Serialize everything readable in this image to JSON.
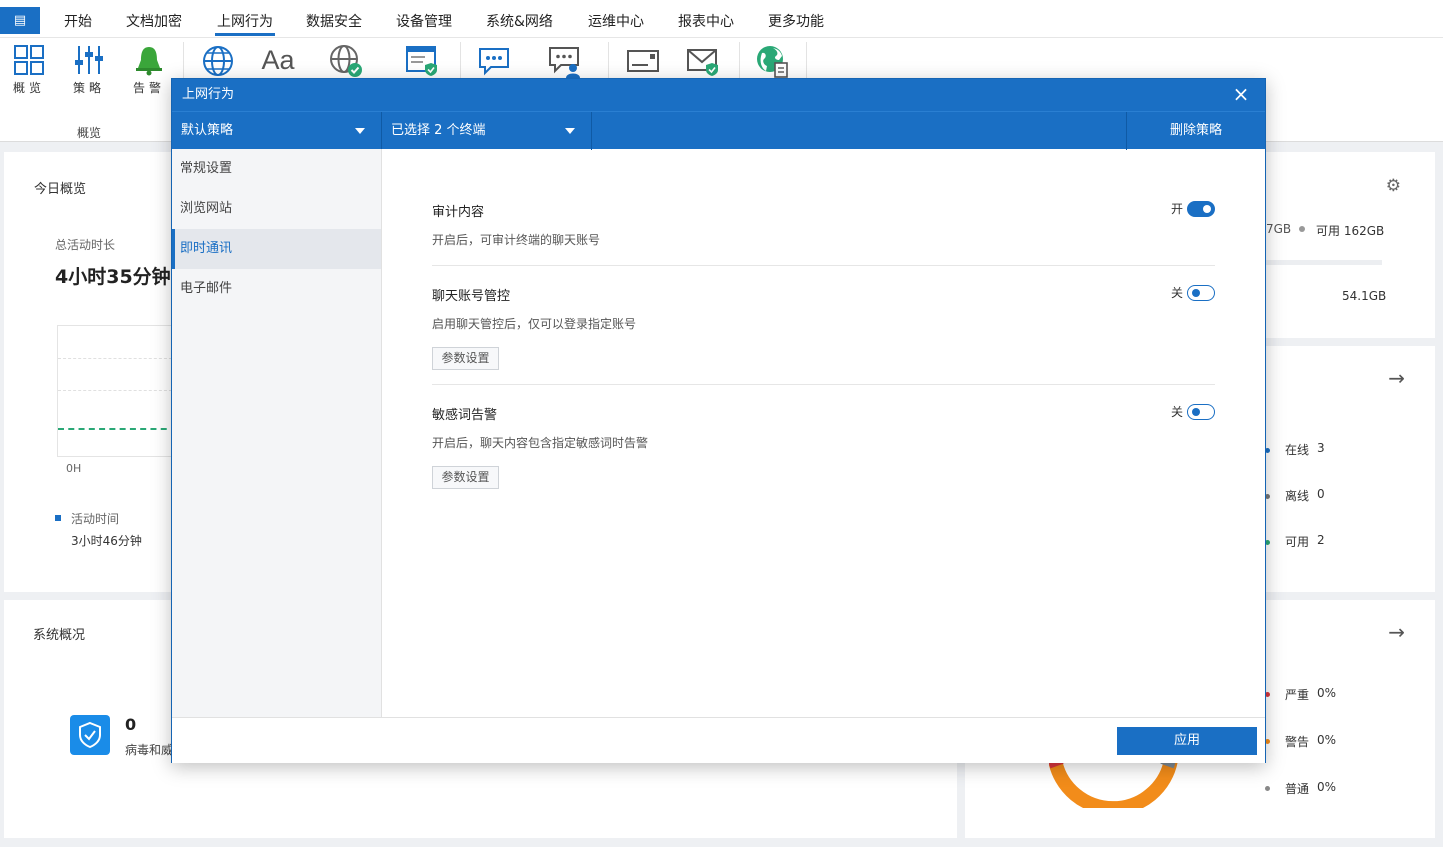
{
  "menu": {
    "app_button": "▤",
    "items": [
      "开始",
      "文档加密",
      "上网行为",
      "数据安全",
      "设备管理",
      "系统&网络",
      "运维中心",
      "报表中心",
      "更多功能"
    ],
    "active_index": 2
  },
  "ribbon": {
    "buttons": [
      {
        "label": "概览",
        "icon": "overview-grid-icon"
      },
      {
        "label": "策略",
        "icon": "sliders-icon"
      },
      {
        "label": "告警",
        "icon": "bell-icon"
      },
      {
        "label": "",
        "icon": "globe-icon"
      },
      {
        "label": "",
        "icon": "font-icon"
      },
      {
        "label": "",
        "icon": "globe-check-icon"
      },
      {
        "label": "",
        "icon": "browser-shield-icon"
      },
      {
        "label": "",
        "icon": "chat-icon"
      },
      {
        "label": "",
        "icon": "chat-user-icon"
      },
      {
        "label": "",
        "icon": "mail-card-icon"
      },
      {
        "label": "",
        "icon": "mail-shield-icon"
      },
      {
        "label": "",
        "icon": "globe-doc-icon"
      }
    ],
    "font_icon_text": "Aa",
    "group_label": "概览"
  },
  "dashboard": {
    "today_title": "今日概览",
    "total_active_label": "总活动时长",
    "total_active_value": "4小时35分钟",
    "axis_label": "0H",
    "legend_label": "活动时间",
    "legend_value": "3小时46分钟",
    "system_title": "系统概况",
    "virus_count": "0",
    "virus_label": "病毒和威",
    "disk_used_partial": "7GB",
    "disk_avail": "可用 162GB",
    "disk_value": "54.1GB",
    "terminals": [
      {
        "label": "在线",
        "value": "3",
        "color": "#1a6fc4"
      },
      {
        "label": "离线",
        "value": "0",
        "color": "#777777"
      },
      {
        "label": "可用",
        "value": "2",
        "color": "#2aa876"
      }
    ],
    "alerts": [
      {
        "label": "严重",
        "value": "0%",
        "color": "#d9363e"
      },
      {
        "label": "警告",
        "value": "0%",
        "color": "#f28c1a"
      },
      {
        "label": "普通",
        "value": "0%",
        "color": "#888888"
      }
    ]
  },
  "modal": {
    "title": "上网行为",
    "close": "×",
    "policy_dropdown": "默认策略",
    "terminal_dropdown": "已选择 2 个终端",
    "delete_policy": "删除策略",
    "side_items": [
      "常规设置",
      "浏览网站",
      "即时通讯",
      "电子邮件"
    ],
    "active_side_index": 2,
    "settings": [
      {
        "title": "审计内容",
        "desc": "开启后，可审计终端的聊天账号",
        "state_text": "开",
        "on": true,
        "param_button": ""
      },
      {
        "title": "聊天账号管控",
        "desc": "启用聊天管控后，仅可以登录指定账号",
        "state_text": "关",
        "on": false,
        "param_button": "参数设置"
      },
      {
        "title": "敏感词告警",
        "desc": "开启后，聊天内容包含指定敏感词时告警",
        "state_text": "关",
        "on": false,
        "param_button": "参数设置"
      }
    ],
    "apply": "应用"
  }
}
